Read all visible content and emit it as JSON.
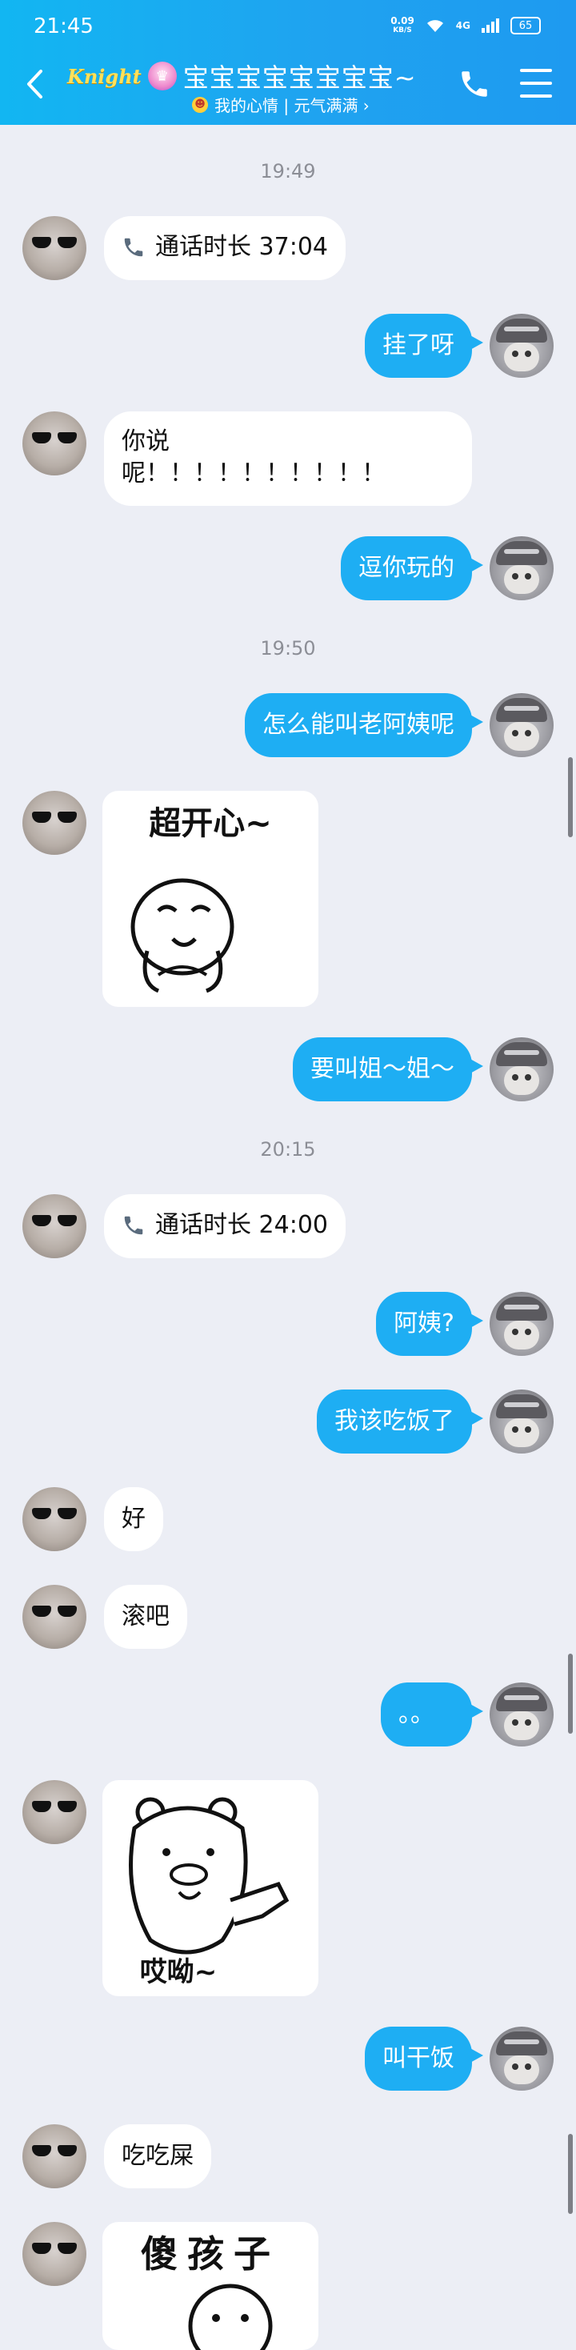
{
  "status_bar": {
    "time": "21:45",
    "net_speed": "0.09",
    "net_unit": "KB/S",
    "battery": "65",
    "signal": "4G"
  },
  "header": {
    "badge": "Knight",
    "title": "宝宝宝宝宝宝宝宝~",
    "mood": "我的心情 | 元气满满 ›"
  },
  "messages": [
    {
      "type": "time",
      "text": "19:49"
    },
    {
      "type": "call",
      "from": "friend",
      "text": "通话时长 37:04"
    },
    {
      "type": "text",
      "from": "me",
      "text": "挂了呀"
    },
    {
      "type": "text",
      "from": "friend",
      "line1": "你说",
      "line2": "呢！！！！！！！！！！"
    },
    {
      "type": "text",
      "from": "me",
      "text": "逗你玩的"
    },
    {
      "type": "time",
      "text": "19:50"
    },
    {
      "type": "text",
      "from": "me",
      "text": "怎么能叫老阿姨呢"
    },
    {
      "type": "sticker",
      "from": "friend",
      "caption": "超开心~"
    },
    {
      "type": "text",
      "from": "me",
      "text": "要叫姐～姐～"
    },
    {
      "type": "time",
      "text": "20:15"
    },
    {
      "type": "call",
      "from": "friend",
      "text": "通话时长 24:00"
    },
    {
      "type": "text",
      "from": "me",
      "text": "阿姨?"
    },
    {
      "type": "text",
      "from": "me",
      "text": "我该吃饭了"
    },
    {
      "type": "text",
      "from": "friend",
      "text": "好"
    },
    {
      "type": "text",
      "from": "friend",
      "text": "滚吧"
    },
    {
      "type": "text",
      "from": "me",
      "text": "。。"
    },
    {
      "type": "sticker",
      "from": "friend",
      "caption": "哎呦~"
    },
    {
      "type": "text",
      "from": "me",
      "text": "叫干饭"
    },
    {
      "type": "text",
      "from": "friend",
      "text": "吃吃屎"
    },
    {
      "type": "sticker",
      "from": "friend",
      "caption": "傻孩子"
    }
  ],
  "colors": {
    "header": "#1eaef3",
    "my_bubble": "#1eaef3",
    "friend_bubble": "#ffffff",
    "background": "#eceef5"
  }
}
